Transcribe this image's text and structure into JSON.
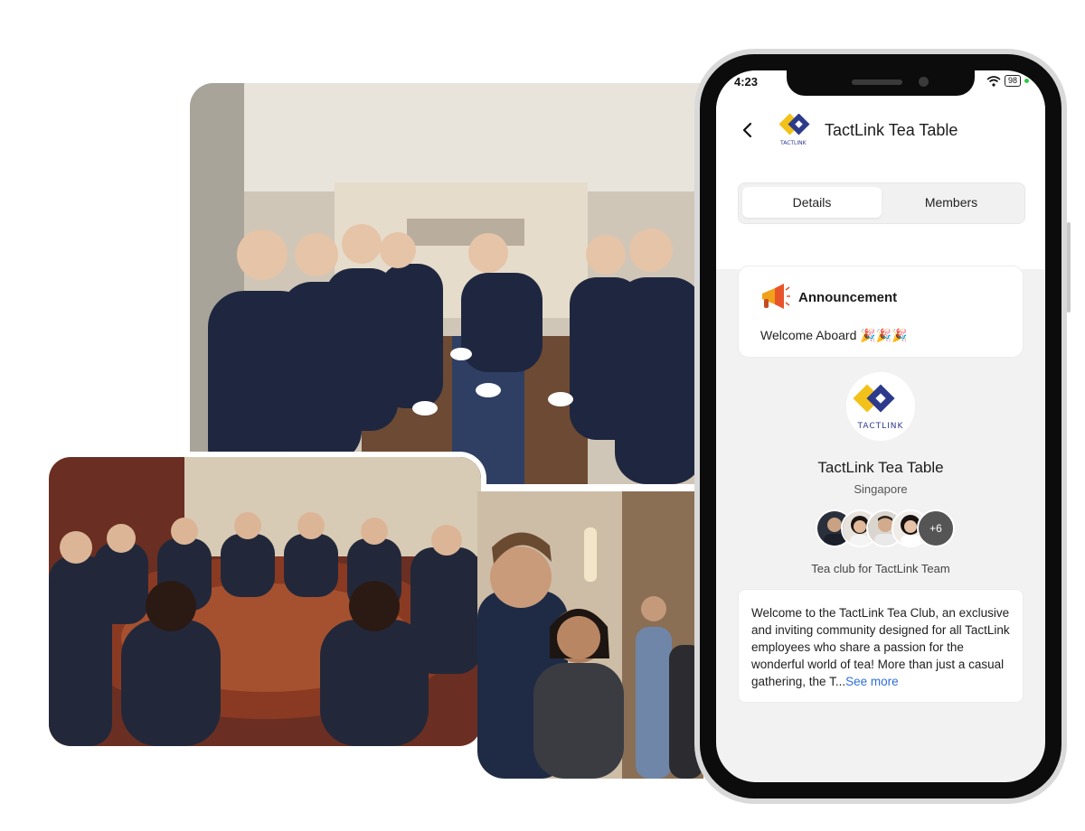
{
  "status_bar": {
    "time": "4:23",
    "battery": "98"
  },
  "header": {
    "title": "TactLink Tea Table",
    "logo_text": "TACTLINK"
  },
  "tabs": {
    "details": "Details",
    "members": "Members"
  },
  "announcement": {
    "title": "Announcement",
    "text": "Welcome Aboard 🎉🎉🎉"
  },
  "club": {
    "name": "TactLink Tea Table",
    "location": "Singapore",
    "extra_members": "+6",
    "tagline": "Tea club for TactLink Team",
    "logo_text": "TACTLINK"
  },
  "about": {
    "text": "Welcome to the TactLink Tea Club, an exclusive and inviting community designed for all TactLink employees who share a passion for the wonderful world of tea! More than just a casual gathering, the T...",
    "see_more": "See more"
  },
  "colors": {
    "brand_yellow": "#f2c21b",
    "brand_navy": "#2d3a8c",
    "link": "#2f6fd8"
  },
  "icons": [
    "back-arrow-icon",
    "megaphone-icon",
    "wifi-icon",
    "battery-icon"
  ]
}
